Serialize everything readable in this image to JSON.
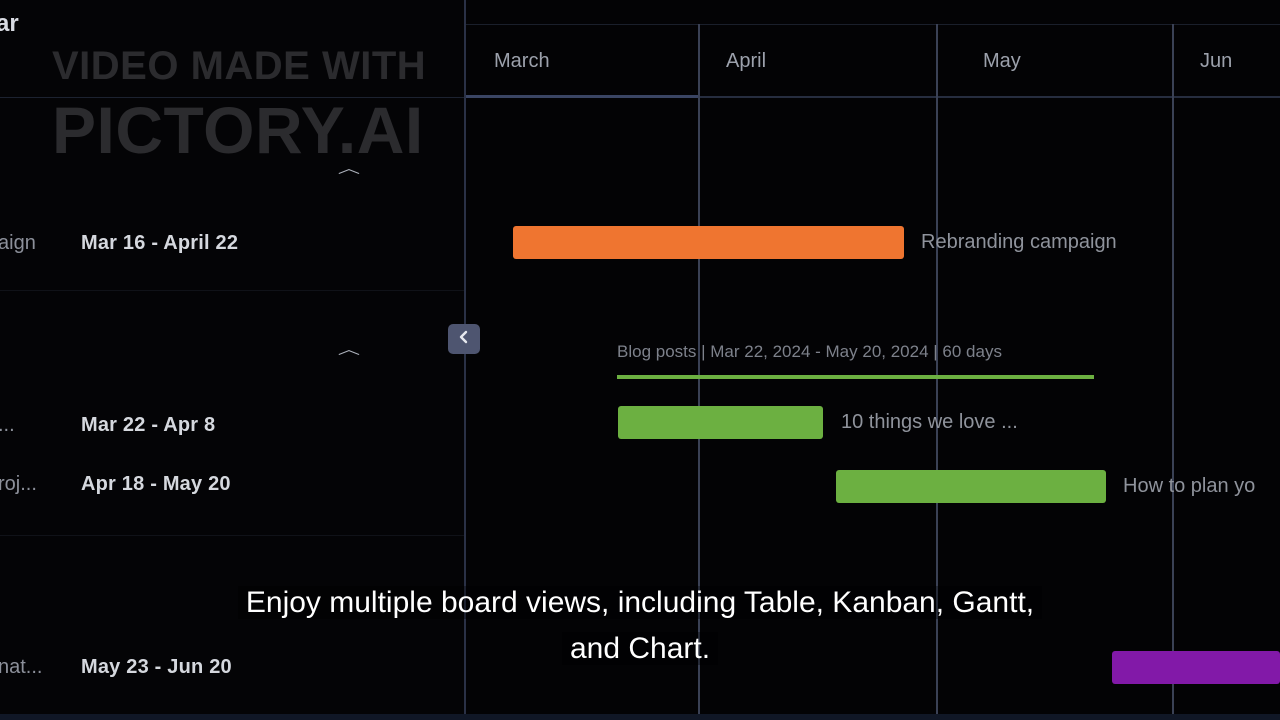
{
  "left_panel": {
    "title_fragment": "ar",
    "tasks": [
      {
        "name": "aign",
        "dates": "Mar 16 - April 22"
      },
      {
        "name": "...",
        "dates": "Mar 22 - Apr 8"
      },
      {
        "name": "roj...",
        "dates": "Apr 18 - May 20"
      },
      {
        "name": "nat...",
        "dates": "May 23 - Jun 20"
      }
    ]
  },
  "timeline": {
    "months": [
      "March",
      "April",
      "May",
      "Jun"
    ],
    "bars": [
      {
        "label": "Rebranding campaign",
        "color": "#ef7530"
      },
      {
        "label": "10 things we love ...",
        "color": "#6cb041"
      },
      {
        "label": "How to plan yo",
        "color": "#6cb041"
      },
      {
        "label": "",
        "color": "#8219a8"
      }
    ],
    "group": {
      "label": "Blog posts | Mar 22, 2024 - May 20, 2024 | 60 days",
      "color": "#6cb041"
    }
  },
  "watermark": {
    "line1": "VIDEO MADE WITH",
    "line2": "PICTORY.AI"
  },
  "caption": {
    "line1": "Enjoy multiple board views, including Table, Kanban, Gantt,",
    "line2": "and Chart."
  },
  "icons": {
    "collapse": "chevron-left-icon",
    "group_toggle": "chevron-up-icon"
  },
  "colors": {
    "background": "#030305",
    "accent": "#4e5570"
  }
}
